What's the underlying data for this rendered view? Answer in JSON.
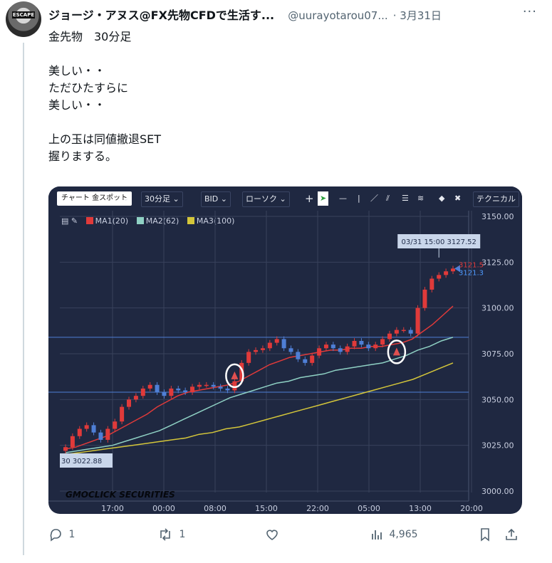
{
  "post": {
    "author_name": "ジョージ・アヌス@FX先物CFDで生活す...",
    "handle": "@uurayotarou07...",
    "date": "· 3月31日",
    "more_label": "···",
    "avatar_text": "ESCAPE",
    "lines": [
      "金先物　30分足",
      "",
      "美しい・・",
      "ただひたすらに",
      "美しい・・",
      "",
      "上の玉は同値撤退SET",
      "握りまする。"
    ]
  },
  "toolbar": {
    "symbol": "チャート 金スポット",
    "timeframe": "30分足",
    "price_type": "BID",
    "chart_type": "ローソク",
    "technical": "テクニカル"
  },
  "legend": {
    "ma1": "MA1(20)",
    "ma2": "MA2(62)",
    "ma3": "MA3(100)",
    "ma1_color": "#e03a3a",
    "ma2_color": "#8fd1c4",
    "ma3_color": "#d4c63a"
  },
  "chart_data": {
    "type": "candlestick",
    "x_tick_labels": [
      "17:00",
      "00:00",
      "08:00",
      "15:00",
      "22:00",
      "05:00",
      "13:00",
      "20:00"
    ],
    "y_tick_labels": [
      "3150.00",
      "3125.00",
      "3100.00",
      "3075.00",
      "3050.00",
      "3025.00",
      "3000.00"
    ],
    "ylim": [
      3000,
      3150
    ],
    "annotations": {
      "high_label": "03/31 15:00 3127.52",
      "low_label": "30 3022.88",
      "last_red": "3121.5",
      "last_blue": "3121.3"
    },
    "watermark": "GMOCLICK SECURITIES",
    "horizontal_lines": [
      3084,
      3054
    ],
    "close_series": [
      3024,
      3030,
      3034,
      3036,
      3032,
      3028,
      3034,
      3038,
      3046,
      3050,
      3052,
      3056,
      3058,
      3054,
      3052,
      3056,
      3055,
      3054,
      3057,
      3058,
      3058,
      3057,
      3056,
      3055,
      3060,
      3070,
      3076,
      3077,
      3078,
      3081,
      3083,
      3078,
      3076,
      3072,
      3070,
      3074,
      3078,
      3080,
      3078,
      3076,
      3079,
      3082,
      3080,
      3078,
      3080,
      3083,
      3086,
      3088,
      3088,
      3086,
      3100,
      3110,
      3116,
      3118,
      3120,
      3121.5
    ],
    "ma1_20": [
      3023,
      3024,
      3026,
      3028,
      3030,
      3033,
      3036,
      3039,
      3042,
      3046,
      3049,
      3052,
      3054,
      3055,
      3056,
      3057,
      3058,
      3060,
      3063,
      3066,
      3069,
      3071,
      3073,
      3074,
      3075,
      3076,
      3077,
      3077,
      3078,
      3078,
      3079,
      3079,
      3080,
      3081,
      3083,
      3087,
      3091,
      3096,
      3101
    ],
    "ma2_62": [
      3021,
      3022,
      3023,
      3024,
      3025,
      3027,
      3029,
      3031,
      3033,
      3036,
      3039,
      3042,
      3045,
      3048,
      3051,
      3053,
      3055,
      3057,
      3059,
      3060,
      3062,
      3063,
      3064,
      3066,
      3067,
      3068,
      3069,
      3070,
      3072,
      3074,
      3077,
      3079,
      3082,
      3084
    ],
    "ma3_100": [
      3020,
      3021,
      3022,
      3023,
      3024,
      3025,
      3026,
      3027,
      3028,
      3029,
      3031,
      3032,
      3034,
      3035,
      3037,
      3039,
      3041,
      3043,
      3045,
      3047,
      3049,
      3051,
      3053,
      3055,
      3057,
      3059,
      3061,
      3064,
      3067,
      3070
    ],
    "markers": [
      3063,
      3076
    ]
  },
  "actions": {
    "replies": "1",
    "reposts": "1",
    "views": "4,965"
  }
}
